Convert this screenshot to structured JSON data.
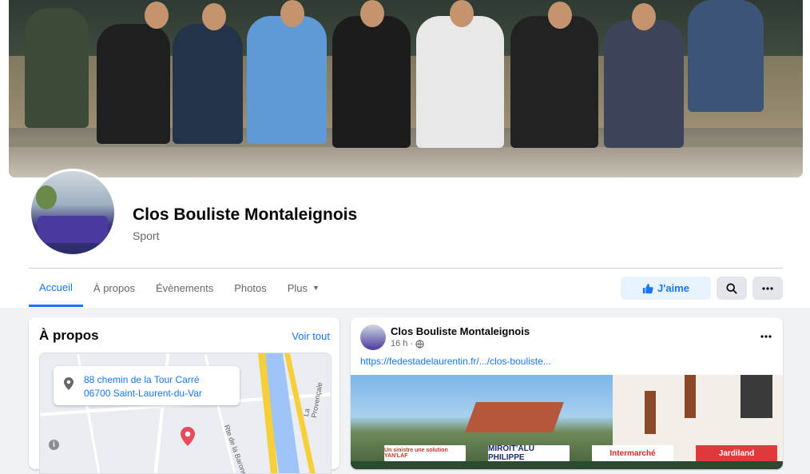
{
  "page": {
    "name": "Clos Bouliste Montaleignois",
    "category": "Sport"
  },
  "tabs": [
    {
      "label": "Accueil",
      "active": true
    },
    {
      "label": "À propos",
      "active": false
    },
    {
      "label": "Évènements",
      "active": false
    },
    {
      "label": "Photos",
      "active": false
    },
    {
      "label": "Plus",
      "active": false
    }
  ],
  "actions": {
    "like_label": "J'aime",
    "search_icon": "search-icon",
    "more_icon": "more-icon"
  },
  "about": {
    "title": "À propos",
    "see_all": "Voir tout",
    "address_line1": "88 chemin de la Tour Carré",
    "address_line2": "06700 Saint-Laurent-du-Var",
    "map_labels": [
      "Rte de la Baronne",
      "La Provençale"
    ]
  },
  "post": {
    "author": "Clos Bouliste Montaleignois",
    "time": "16 h",
    "link": "https://fedestadelaurentin.fr/.../clos-bouliste...",
    "banners": [
      "Un sinistre une solution YAN'LAF",
      "MIROIT'ALU PHILIPPE",
      "Intermarché",
      "Jardiland"
    ]
  },
  "colors": {
    "accent": "#1877f2",
    "background": "#f0f2f5",
    "like_bg": "#e7f3ff",
    "map_pin": "#e94a5c"
  }
}
